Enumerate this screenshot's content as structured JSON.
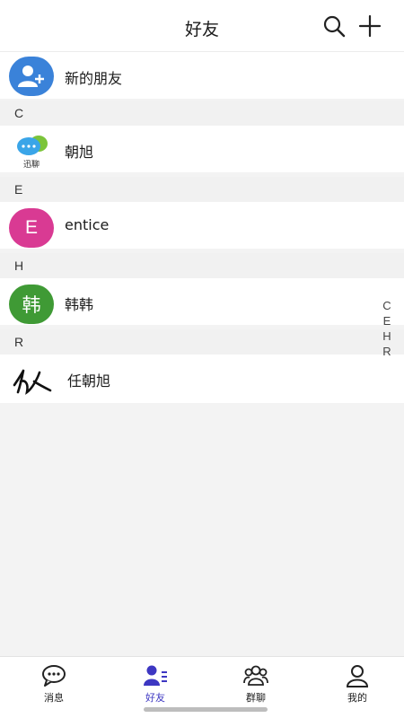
{
  "header": {
    "title": "好友",
    "search_icon": "search-icon",
    "add_icon": "plus-icon"
  },
  "new_friend": {
    "label": "新的朋友",
    "icon": "add-user-icon",
    "color": "#3a82d9"
  },
  "sections": [
    {
      "letter": "C",
      "contacts": [
        {
          "name": "朝旭",
          "avatar_text": "迅聊",
          "avatar_type": "app-logo"
        }
      ]
    },
    {
      "letter": "E",
      "contacts": [
        {
          "name": "entice",
          "avatar_text": "E",
          "avatar_color": "#d93a93"
        }
      ]
    },
    {
      "letter": "H",
      "contacts": [
        {
          "name": "韩韩",
          "avatar_text": "韩",
          "avatar_color": "#3f9a35"
        }
      ]
    },
    {
      "letter": "R",
      "contacts": [
        {
          "name": "任朝旭",
          "avatar_type": "signature-image"
        }
      ]
    }
  ],
  "index_letters": [
    "C",
    "E",
    "H",
    "R"
  ],
  "tabbar": {
    "tabs": [
      {
        "label": "消息",
        "icon": "chat-bubble-icon",
        "active": false
      },
      {
        "label": "好友",
        "icon": "contacts-icon",
        "active": true
      },
      {
        "label": "群聊",
        "icon": "group-icon",
        "active": false
      },
      {
        "label": "我的",
        "icon": "person-icon",
        "active": false
      }
    ],
    "active_color": "#3d37c2"
  }
}
